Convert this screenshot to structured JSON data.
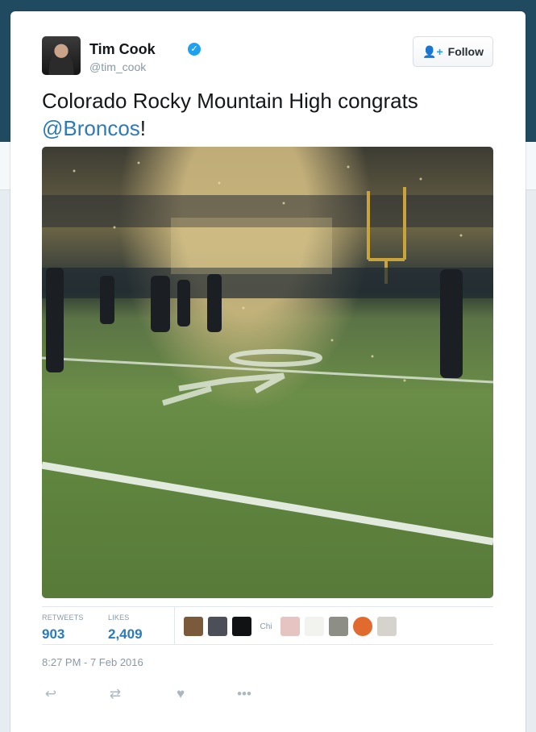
{
  "user": {
    "name": "Tim Cook",
    "handle": "@tim_cook",
    "verified_icon": "verified-badge-icon",
    "follow_label": "Follow"
  },
  "tweet": {
    "text_main": "Colorado Rocky Mountain High congrats ",
    "mention": "@Broncos",
    "text_end": "!",
    "timestamp": "8:27 PM - 7 Feb 2016"
  },
  "stats": {
    "retweets_label": "RETWEETS",
    "retweets_count": "903",
    "likes_label": "LIKES",
    "likes_count": "2,409"
  },
  "likers": [
    {
      "label": ""
    },
    {
      "label": ""
    },
    {
      "label": ""
    },
    {
      "label": "Chi"
    },
    {
      "label": ""
    },
    {
      "label": ""
    },
    {
      "label": ""
    },
    {
      "label": ""
    },
    {
      "label": ""
    }
  ],
  "actions": [
    "reply-icon",
    "retweet-icon",
    "like-icon",
    "more-icon"
  ],
  "colors": {
    "link": "#2b7bb9",
    "verified": "#1da1f2",
    "muted": "#8899a6"
  }
}
